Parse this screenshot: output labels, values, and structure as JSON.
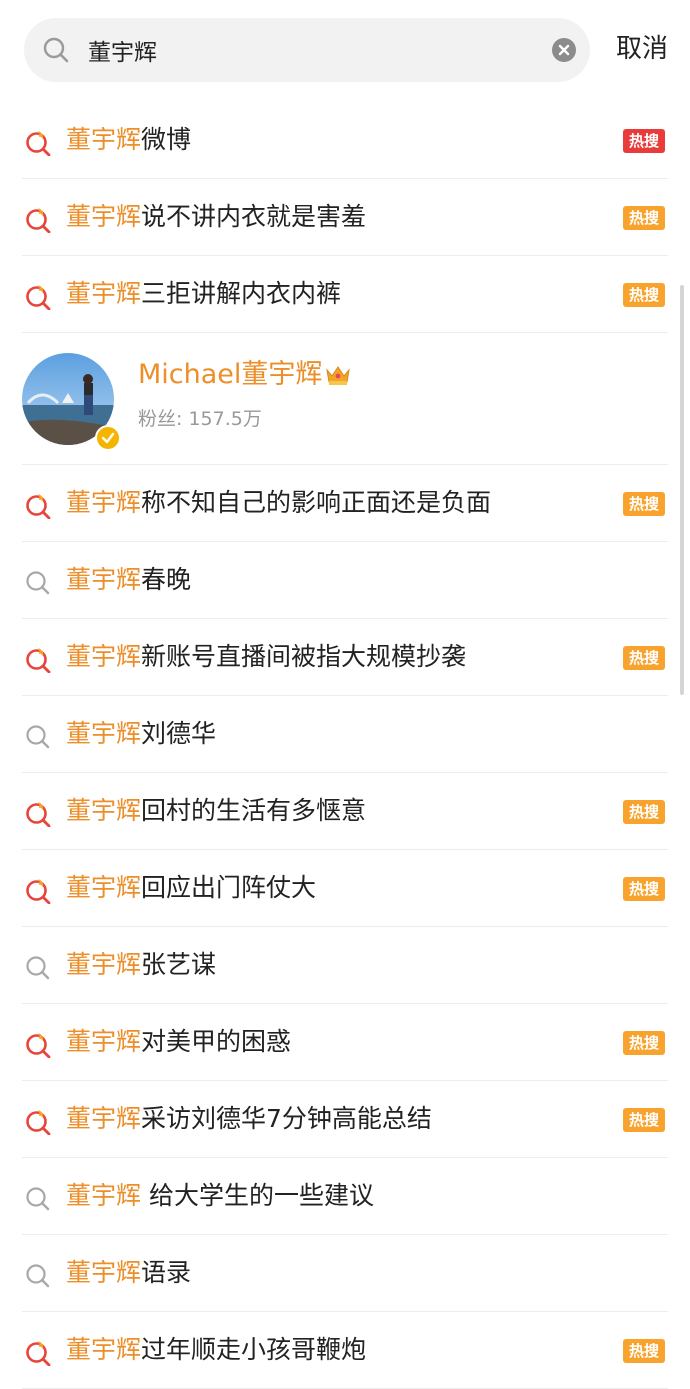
{
  "colors": {
    "keyword": "#ec8f2a",
    "hot_badge": "#f8a32e",
    "hot_badge_top": "#ea3b3b",
    "hot_icon": "#e8443a",
    "verified": "#f5b400"
  },
  "search": {
    "value": "董宇辉",
    "cancel_label": "取消"
  },
  "rows_top": [
    {
      "keyword": "董宇辉",
      "rest": "微博",
      "hot": true,
      "badge": "热搜",
      "badge_color": "red",
      "icon": "hot-search-icon"
    },
    {
      "keyword": "董宇辉",
      "rest": "说不讲内衣就是害羞",
      "hot": true,
      "badge": "热搜",
      "icon": "hot-search-icon"
    },
    {
      "keyword": "董宇辉",
      "rest": "三拒讲解内衣内裤",
      "hot": true,
      "badge": "热搜",
      "icon": "hot-search-icon"
    }
  ],
  "user_card": {
    "name": "Michael董宇辉",
    "fans": "粉丝: 157.5万",
    "verified_icon": "verified-badge-icon",
    "crown_icon": "crown-icon"
  },
  "rows_bottom": [
    {
      "keyword": "董宇辉",
      "rest": "称不知自己的影响正面还是负面",
      "hot": true,
      "badge": "热搜"
    },
    {
      "keyword": "董宇辉",
      "rest": "春晚",
      "hot": false,
      "badge": ""
    },
    {
      "keyword": "董宇辉",
      "rest": "新账号直播间被指大规模抄袭",
      "hot": true,
      "badge": "热搜"
    },
    {
      "keyword": "董宇辉",
      "rest": "刘德华",
      "hot": false,
      "badge": ""
    },
    {
      "keyword": "董宇辉",
      "rest": "回村的生活有多惬意",
      "hot": true,
      "badge": "热搜"
    },
    {
      "keyword": "董宇辉",
      "rest": "回应出门阵仗大",
      "hot": true,
      "badge": "热搜"
    },
    {
      "keyword": "董宇辉",
      "rest": "张艺谋",
      "hot": false,
      "badge": ""
    },
    {
      "keyword": "董宇辉",
      "rest": "对美甲的困惑",
      "hot": true,
      "badge": "热搜"
    },
    {
      "keyword": "董宇辉",
      "rest": "采访刘德华7分钟高能总结",
      "hot": true,
      "badge": "热搜"
    },
    {
      "keyword": "董宇辉",
      "rest": " 给大学生的一些建议",
      "hot": false,
      "badge": ""
    },
    {
      "keyword": "董宇辉",
      "rest": "语录",
      "hot": false,
      "badge": ""
    },
    {
      "keyword": "董宇辉",
      "rest": "过年顺走小孩哥鞭炮",
      "hot": true,
      "badge": "热搜"
    }
  ]
}
